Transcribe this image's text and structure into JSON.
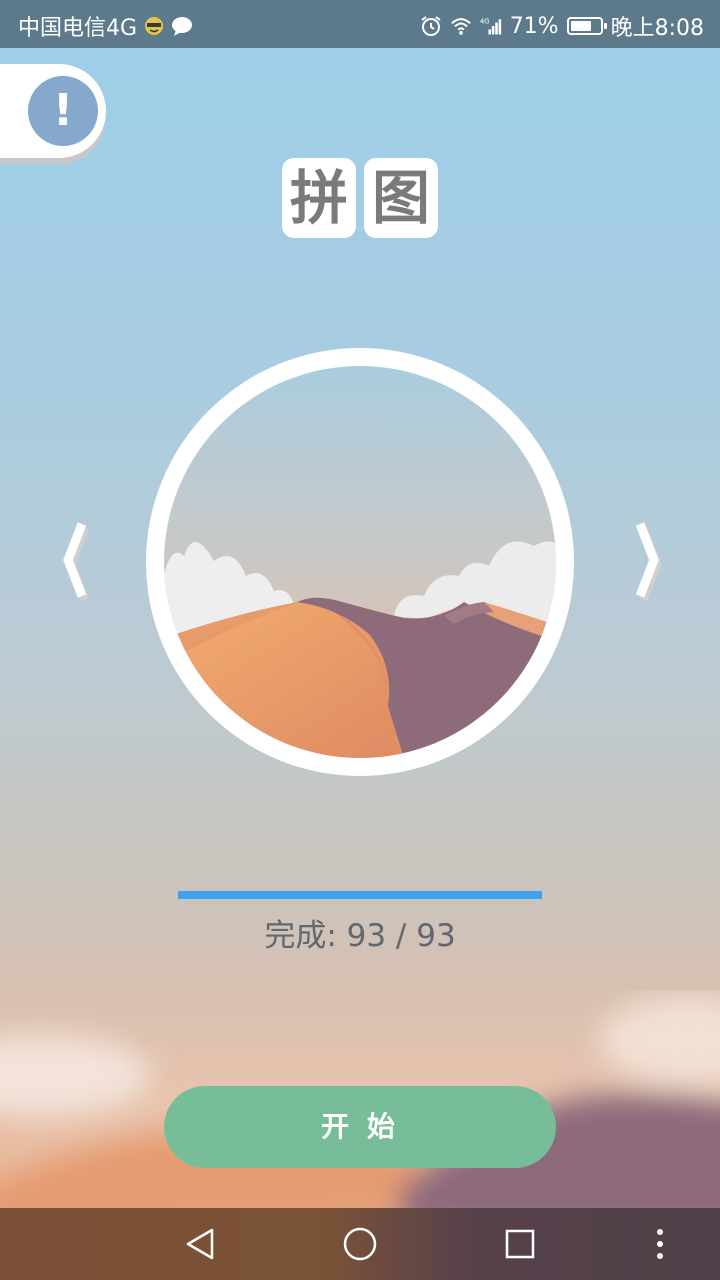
{
  "status_bar": {
    "carrier": "中国电信4G",
    "battery_percent": "71%",
    "battery_level": 0.71,
    "time": "晚上8:08",
    "icons": [
      "emoji-face-icon",
      "chat-bubble-icon",
      "alarm-clock-icon",
      "wifi-icon",
      "signal-4g-icon",
      "battery-icon"
    ]
  },
  "info_button": {
    "label": "!"
  },
  "title": {
    "chars": [
      "拼",
      "图"
    ]
  },
  "nav_arrows": {
    "prev": "〈",
    "next": "〉"
  },
  "progress": {
    "label": "完成:",
    "completed": 93,
    "total": 93,
    "text": "完成: 93 / 93",
    "fraction": 1.0
  },
  "start_button": {
    "label": "开 始"
  },
  "colors": {
    "accent_blue": "#3ba3ef",
    "start_green": "#78bd9a",
    "info_blue": "#86a8cc",
    "status_bar": "#5c7a8c"
  },
  "system_nav": {
    "icons": [
      "back-triangle-icon",
      "home-circle-icon",
      "recents-square-icon",
      "more-vertical-icon"
    ]
  }
}
